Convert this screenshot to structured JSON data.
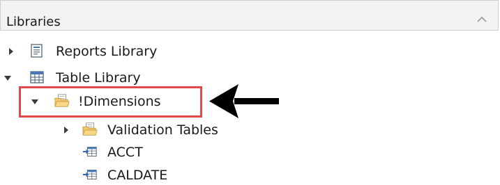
{
  "panel": {
    "title": "Libraries"
  },
  "tree": {
    "items": [
      {
        "label": "Reports Library",
        "expanded": false,
        "icon": "report-icon"
      },
      {
        "label": "Table Library",
        "expanded": true,
        "icon": "table-icon"
      },
      {
        "label": "!Dimensions",
        "expanded": true,
        "icon": "folder-icon"
      },
      {
        "label": "Validation Tables",
        "expanded": false,
        "icon": "folder-icon"
      },
      {
        "label": "ACCT",
        "icon": "linked-table-icon"
      },
      {
        "label": "CALDATE",
        "icon": "linked-table-icon"
      }
    ]
  },
  "colors": {
    "highlight": "#e0484a",
    "folder": "#f2c66d",
    "header_bg": "#f3f3f3"
  }
}
